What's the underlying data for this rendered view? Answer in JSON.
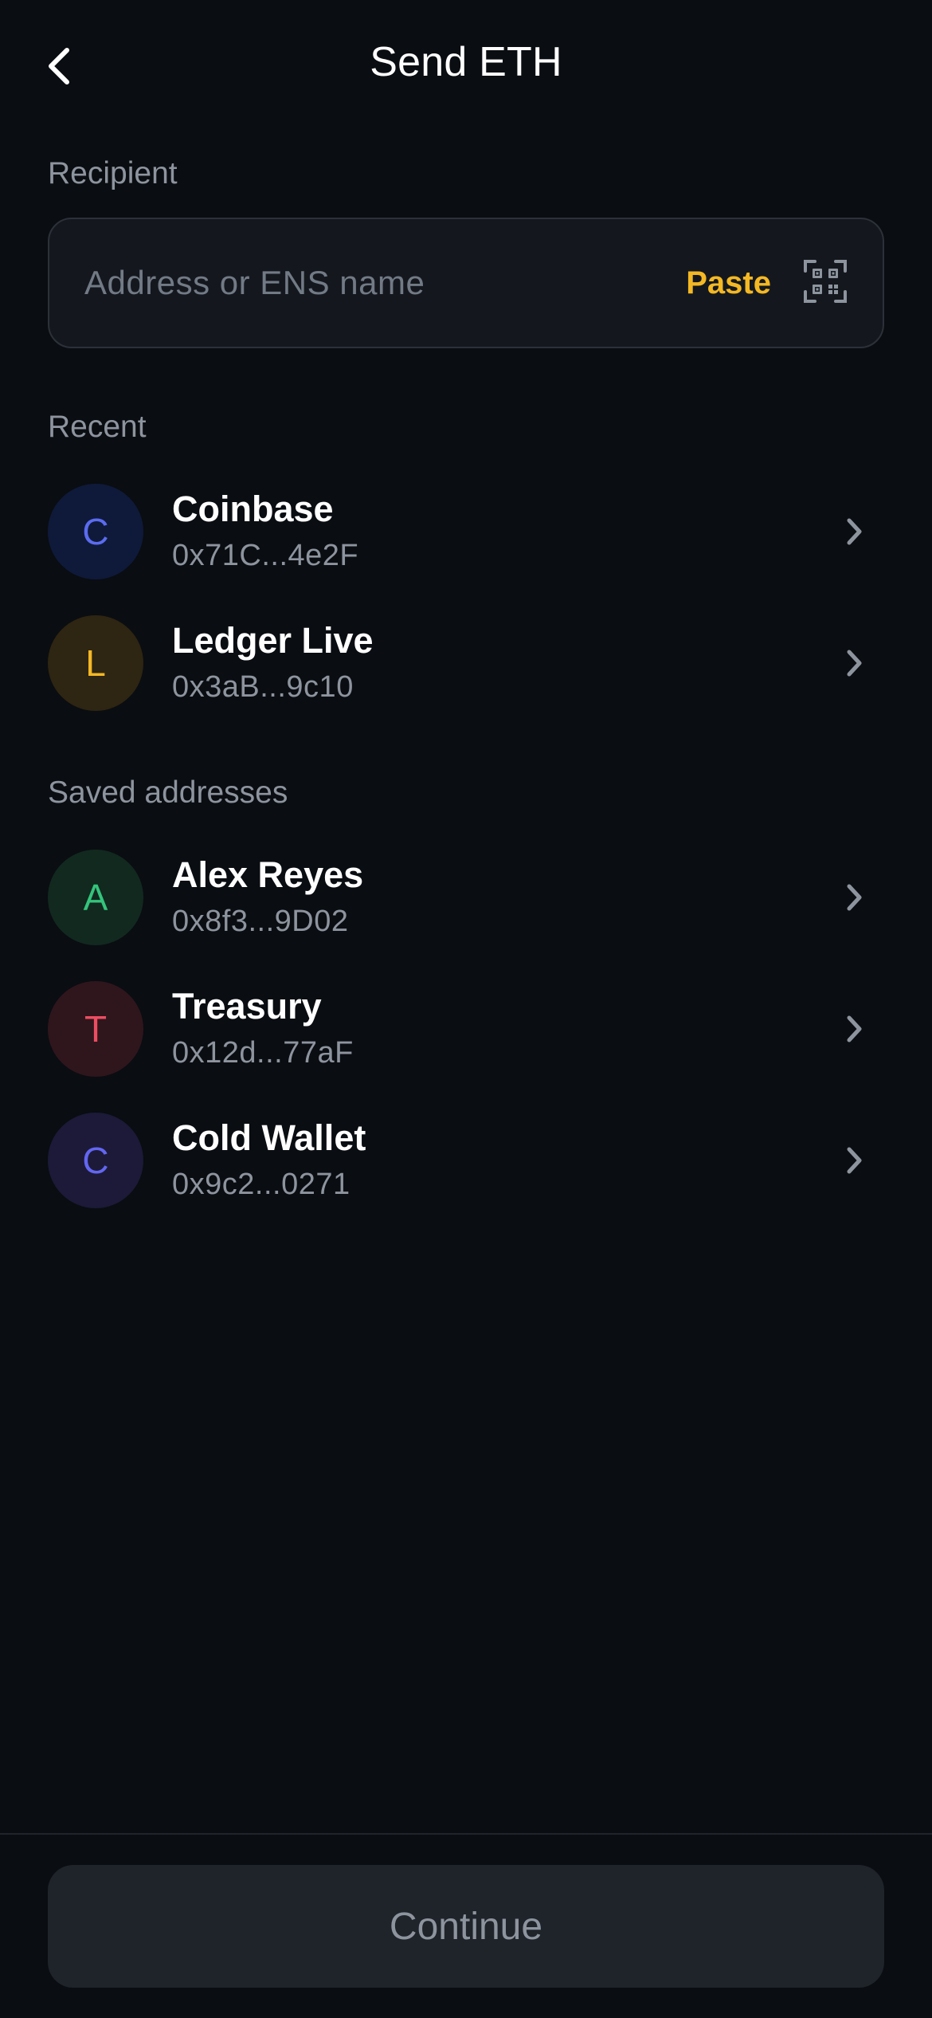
{
  "header": {
    "title": "Send ETH",
    "back_icon": "chevron-left-icon"
  },
  "recipient": {
    "label": "Recipient",
    "placeholder": "Address or ENS name",
    "value": "",
    "paste_label": "Paste",
    "scan_icon": "qr-code-icon"
  },
  "recent": {
    "label": "Recent",
    "items": [
      {
        "initial": "C",
        "name": "Coinbase",
        "address": "0x71C...4e2F",
        "avatar_bg": "#0f1a3a",
        "avatar_fg": "#5b6cf0"
      },
      {
        "initial": "L",
        "name": "Ledger Live",
        "address": "0x3aB...9c10",
        "avatar_bg": "#2e2512",
        "avatar_fg": "#f4b824"
      }
    ]
  },
  "saved": {
    "label": "Saved addresses",
    "items": [
      {
        "initial": "A",
        "name": "Alex Reyes",
        "address": "0x8f3...9D02",
        "avatar_bg": "#12291f",
        "avatar_fg": "#34c47c"
      },
      {
        "initial": "T",
        "name": "Treasury",
        "address": "0x12d...77aF",
        "avatar_bg": "#2f161c",
        "avatar_fg": "#ec4d62"
      },
      {
        "initial": "C",
        "name": "Cold Wallet",
        "address": "0x9c2...0271",
        "avatar_bg": "#1c1a38",
        "avatar_fg": "#6366f1"
      }
    ]
  },
  "footer": {
    "continue_label": "Continue"
  },
  "colors": {
    "background": "#0a0d11",
    "accent": "#f4b824",
    "muted_text": "#8d949e",
    "input_border": "#2c3139"
  }
}
